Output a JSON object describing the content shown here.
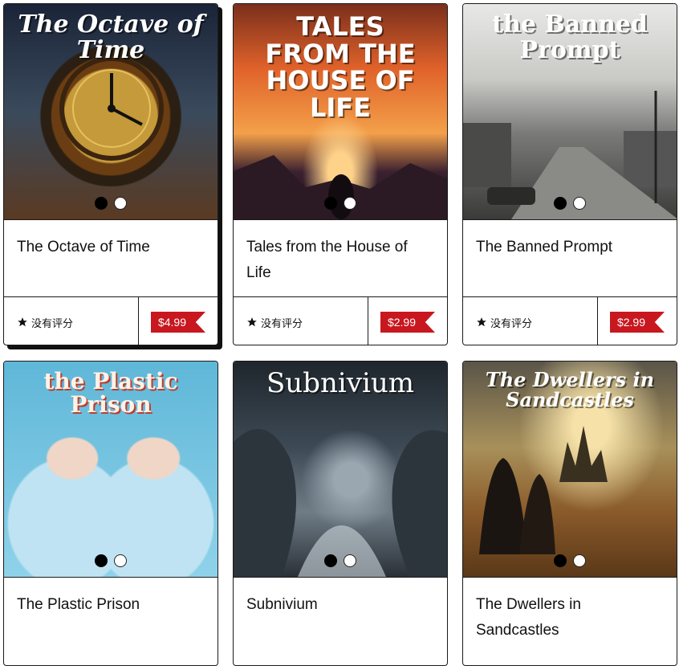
{
  "books": [
    {
      "title": "The Octave of Time",
      "cover_text": "The Octave of Time",
      "rating": "没有评分",
      "price": "$4.99"
    },
    {
      "title": "Tales from the House of Life",
      "cover_text": "TALES FROM THE HOUSE OF LIFE",
      "rating": "没有评分",
      "price": "$2.99"
    },
    {
      "title": "The Banned Prompt",
      "cover_text": "the Banned Prompt",
      "rating": "没有评分",
      "price": "$2.99"
    },
    {
      "title": "The Plastic Prison",
      "cover_text": "the Plastic Prison"
    },
    {
      "title": "Subnivium",
      "cover_text": "Subnivium"
    },
    {
      "title": "The Dwellers in Sandcastles",
      "cover_text": "The Dwellers in Sandcastles"
    }
  ],
  "colors": {
    "price_tag": "#c8171e",
    "border": "#1a1a1a"
  }
}
